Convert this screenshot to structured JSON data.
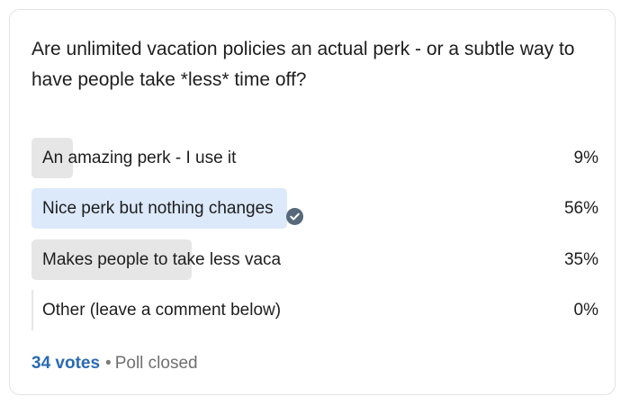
{
  "poll": {
    "question": "Are unlimited vacation policies an actual perk - or a subtle way to have people take *less* time off?",
    "options": [
      {
        "label": "An amazing perk - I use it",
        "percent_text": "9%",
        "share": 0.09,
        "selected": false,
        "bar_color": "#e6e6e6"
      },
      {
        "label": "Nice perk but nothing changes",
        "percent_text": "56%",
        "share": 0.56,
        "selected": true,
        "bar_color": "#dce9fb"
      },
      {
        "label": "Makes people to take less vaca",
        "percent_text": "35%",
        "share": 0.35,
        "selected": false,
        "bar_color": "#e6e6e6"
      },
      {
        "label": "Other (leave a comment below)",
        "percent_text": "0%",
        "share": 0.0,
        "selected": false,
        "bar_color": "#e6e6e6"
      }
    ],
    "selected_icon": "check-circle-icon",
    "accent_color": "#2a6ab4",
    "footer": {
      "votes": "34 votes",
      "separator": "•",
      "status": "Poll closed"
    }
  }
}
